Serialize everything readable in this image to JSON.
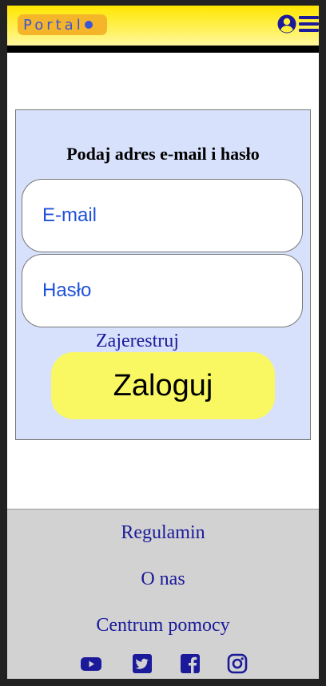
{
  "header": {
    "logo_text": "Portal",
    "icons": [
      "user-circle-icon",
      "hamburger-menu-icon"
    ]
  },
  "login": {
    "title": "Podaj adres e-mail i hasło",
    "email_placeholder": "E-mail",
    "password_placeholder": "Hasło",
    "register_label": "Zajerestruj",
    "submit_label": "Zaloguj"
  },
  "footer": {
    "links": [
      "Regulamin",
      "O nas",
      "Centrum pomocy"
    ],
    "social_icons": [
      "youtube-icon",
      "twitter-icon",
      "facebook-icon",
      "instagram-icon"
    ]
  },
  "colors": {
    "header_yellow": "#ffe600",
    "logo_bg": "#f5b52a",
    "accent_blue": "#1f52d9",
    "link_navy": "#1a1a9a",
    "login_bg": "#d8e1fb",
    "button_yellow": "#f9f862",
    "footer_bg": "#d2d2d2"
  }
}
